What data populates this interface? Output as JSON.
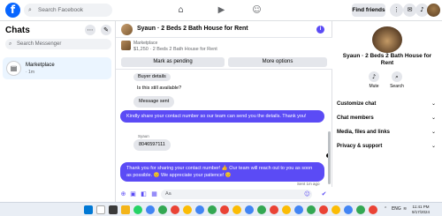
{
  "topbar": {
    "logo": "f",
    "search_placeholder": "Search Facebook",
    "nav_icons": [
      "home-icon",
      "video-icon",
      "groups-icon"
    ],
    "find_friends": "Find friends",
    "menu_icon": "grid-menu-icon",
    "messenger_icon": "messenger-icon",
    "notifications_icon": "bell-icon"
  },
  "chats": {
    "title": "Chats",
    "search_placeholder": "Search Messenger",
    "items": [
      {
        "name": "Marketplace",
        "sub": "· 1m"
      }
    ]
  },
  "conversation": {
    "title": "Syaun · 2 Beds 2 Bath House for Rent",
    "marketplace_label": "Marketplace",
    "listing": "$1,250 · 2 Beds 2 Bath House for Rent",
    "mark_pending": "Mark as pending",
    "more_options": "More options",
    "messages": {
      "buyer_details": "Buyer details",
      "question": "Is this still available?",
      "message_sent": "Message sent",
      "outgoing_1": "Kindly share your contact number so our team can send you the details. Thank you!",
      "sender_name": "Syaun",
      "phone": "8046597111",
      "outgoing_2": "Thank you for sharing your contact number! 👍 Our team will reach out to you as soon as possible. 😊 We appreciate your patience! 😊",
      "sent_status": "Sent 1m ago"
    },
    "composer_placeholder": "Aa"
  },
  "profile_panel": {
    "name": "Syaun · 2 Beds 2 Bath House for Rent",
    "mute": "Mute",
    "search": "Search",
    "sections": [
      "Customize chat",
      "Chat members",
      "Media, files and links",
      "Privacy & support"
    ]
  },
  "taskbar": {
    "time": "11:41 PM",
    "date": "9/17/2024",
    "lang": "ENG"
  },
  "colors": {
    "brand": "#0866ff",
    "accent": "#5b4bf5"
  }
}
